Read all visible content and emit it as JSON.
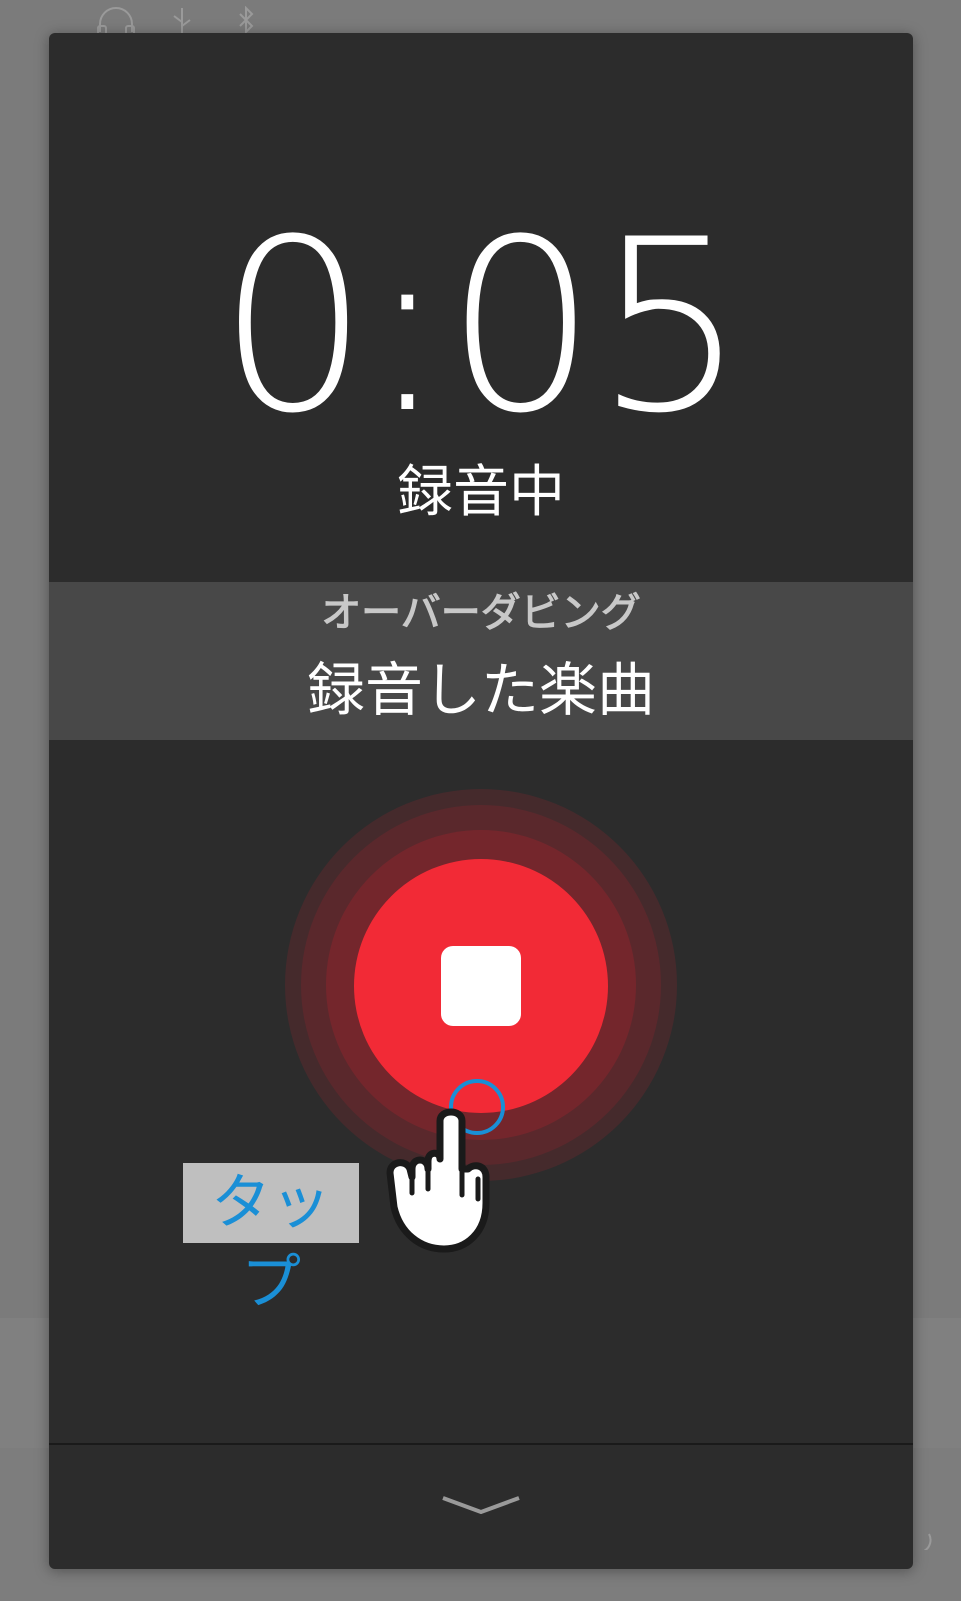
{
  "background": {
    "status_icons": [
      "headphones-icon",
      "usb-icon",
      "bluetooth-icon"
    ]
  },
  "recording": {
    "elapsed_time": "0:05",
    "state_label": "録音中"
  },
  "mode": {
    "label": "オーバーダビング",
    "value": "録音した楽曲"
  },
  "controls": {
    "stop_icon": "stop-icon",
    "collapse_icon": "chevron-down-icon"
  },
  "hint": {
    "tap_label": "タップ",
    "pointer_icon": "hand-pointer-icon"
  },
  "colors": {
    "dialog_bg": "#2c2c2c",
    "band_bg": "#484848",
    "record_red": "#f22a36",
    "hint_blue": "#1a8fd6"
  }
}
